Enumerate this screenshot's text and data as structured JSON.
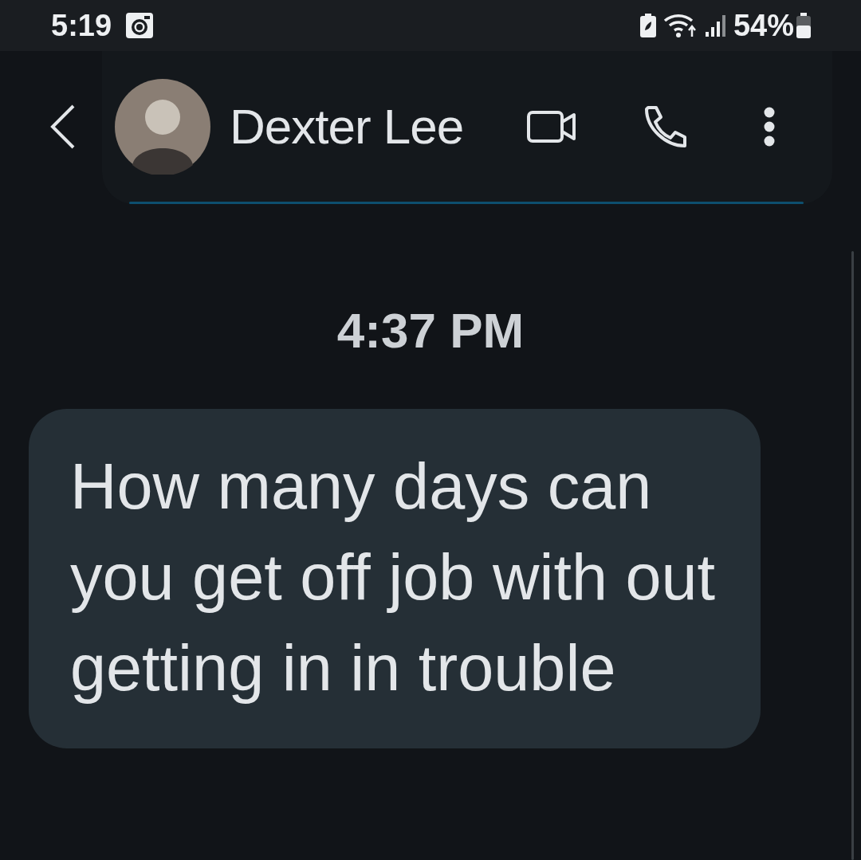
{
  "status_bar": {
    "time": "5:19",
    "battery": "54%"
  },
  "header": {
    "contact_name": "Dexter Lee"
  },
  "messages": [
    {
      "timestamp": "4:37 PM",
      "text": "How many days can you get off job with out getting in in trouble",
      "outgoing": false
    }
  ]
}
